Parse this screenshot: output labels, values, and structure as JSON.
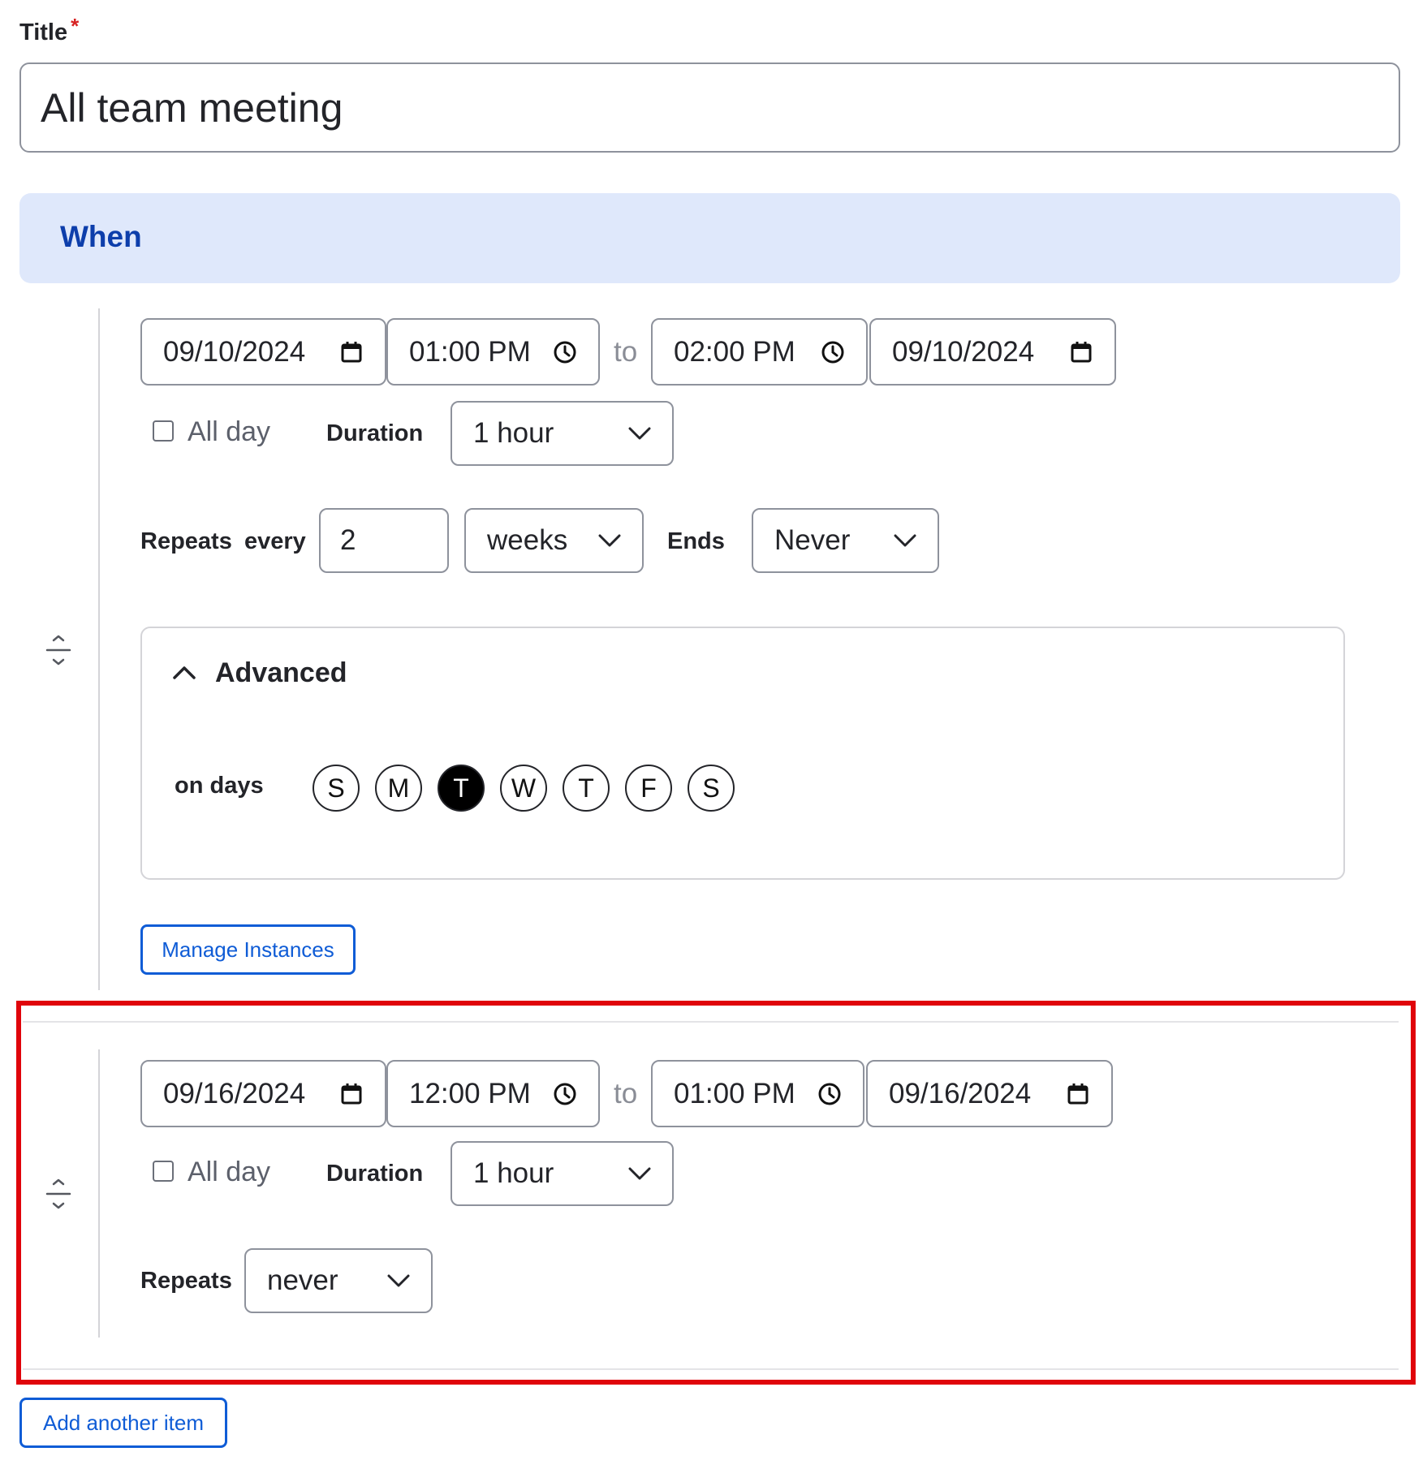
{
  "title": {
    "label": "Title",
    "required_marker": "*",
    "value": "All team meeting"
  },
  "when": {
    "heading": "When"
  },
  "item1": {
    "start_date": "09/10/2024",
    "start_time": "01:00 PM",
    "to": "to",
    "end_time": "02:00 PM",
    "end_date": "09/10/2024",
    "all_day_label": "All day",
    "all_day_checked": false,
    "duration_label": "Duration",
    "duration_value": "1 hour",
    "repeats_label": "Repeats",
    "every_label": "every",
    "interval_value": "2",
    "unit_value": "weeks",
    "ends_label": "Ends",
    "ends_value": "Never",
    "advanced": {
      "title": "Advanced",
      "on_days_label": "on days",
      "days": [
        {
          "letter": "S",
          "selected": false
        },
        {
          "letter": "M",
          "selected": false
        },
        {
          "letter": "T",
          "selected": true
        },
        {
          "letter": "W",
          "selected": false
        },
        {
          "letter": "T",
          "selected": false
        },
        {
          "letter": "F",
          "selected": false
        },
        {
          "letter": "S",
          "selected": false
        }
      ]
    },
    "manage_instances_label": "Manage Instances"
  },
  "item2": {
    "start_date": "09/16/2024",
    "start_time": "12:00 PM",
    "to": "to",
    "end_time": "01:00 PM",
    "end_date": "09/16/2024",
    "all_day_label": "All day",
    "all_day_checked": false,
    "duration_label": "Duration",
    "duration_value": "1 hour",
    "repeats_label": "Repeats",
    "repeats_value": "never"
  },
  "add_another_label": "Add another item",
  "colors": {
    "accent_blue": "#0f5cd6",
    "when_heading_blue": "#0d3eab",
    "when_bar_bg": "#dfe8fb",
    "highlight_red": "#e0040b"
  },
  "icons": [
    "calendar-icon",
    "clock-icon",
    "chevron-down-icon",
    "chevron-up-icon",
    "drag-handle-icon"
  ]
}
